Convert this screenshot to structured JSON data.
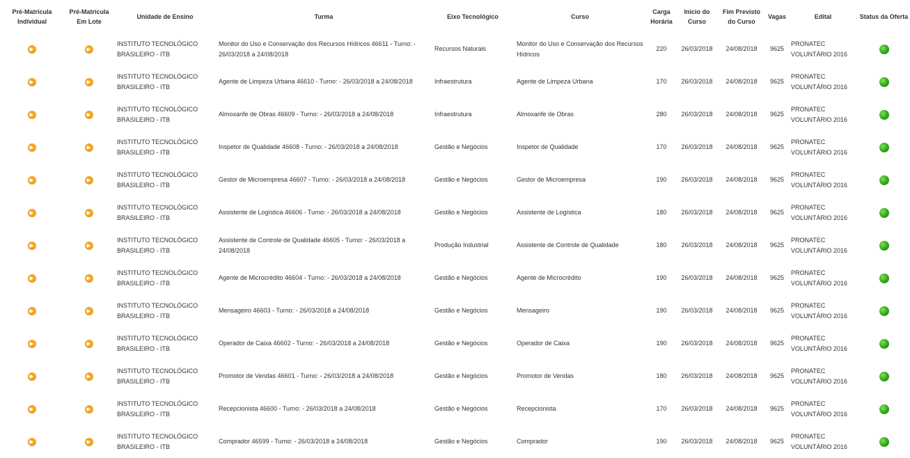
{
  "headers": {
    "pre_individual": "Pré-Matrícula Individual",
    "pre_lote": "Pré-Matrícula Em Lote",
    "unidade": "Unidade de Ensino",
    "turma": "Turma",
    "eixo": "Eixo Tecnológico",
    "curso": "Curso",
    "carga": "Carga Horária",
    "inicio": "Inicio do Curso",
    "fim": "Fim Previsto do Curso",
    "vagas": "Vagas",
    "edital": "Edital",
    "status": "Status da Oferta"
  },
  "icons": {
    "pre_matricula": "arrow-right-circle-icon",
    "status": "green-status-dot-icon"
  },
  "colors": {
    "arrow_button": "#f5a623",
    "status_active": "#2fa51a"
  },
  "rows": [
    {
      "unidade": "INSTITUTO TECNOLÓGICO BRASILEIRO - ITB",
      "turma": "Monitor do Uso e Conservação dos Recursos Hídricos 46611 - Turno: - 26/03/2018 a 24/08/2018",
      "eixo": "Recursos Naturais",
      "curso": "Monitor do Uso e Conservação dos Recursos Hídricos",
      "carga": "220",
      "inicio": "26/03/2018",
      "fim": "24/08/2018",
      "vagas": "9625",
      "edital": "PRONATEC VOLUNTÁRIO 2016"
    },
    {
      "unidade": "INSTITUTO TECNOLÓGICO BRASILEIRO - ITB",
      "turma": "Agente de Limpeza Urbana 46610 - Turno: - 26/03/2018 a 24/08/2018",
      "eixo": "Infraestrutura",
      "curso": "Agente de Limpeza Urbana",
      "carga": "170",
      "inicio": "26/03/2018",
      "fim": "24/08/2018",
      "vagas": "9625",
      "edital": "PRONATEC VOLUNTÁRIO 2016"
    },
    {
      "unidade": "INSTITUTO TECNOLÓGICO BRASILEIRO - ITB",
      "turma": "Almoxarife de Obras 46609 - Turno: - 26/03/2018 a 24/08/2018",
      "eixo": "Infraestrutura",
      "curso": "Almoxarife de Obras",
      "carga": "280",
      "inicio": "26/03/2018",
      "fim": "24/08/2018",
      "vagas": "9625",
      "edital": "PRONATEC VOLUNTÁRIO 2016"
    },
    {
      "unidade": "INSTITUTO TECNOLÓGICO BRASILEIRO - ITB",
      "turma": "Inspetor de Qualidade 46608 - Turno: - 26/03/2018 a 24/08/2018",
      "eixo": "Gestão e Negócios",
      "curso": "Inspetor de Qualidade",
      "carga": "170",
      "inicio": "26/03/2018",
      "fim": "24/08/2018",
      "vagas": "9625",
      "edital": "PRONATEC VOLUNTÁRIO 2016"
    },
    {
      "unidade": "INSTITUTO TECNOLÓGICO BRASILEIRO - ITB",
      "turma": "Gestor de Microempresa 46607 - Turno: - 26/03/2018 a 24/08/2018",
      "eixo": "Gestão e Negócios",
      "curso": "Gestor de Microempresa",
      "carga": "190",
      "inicio": "26/03/2018",
      "fim": "24/08/2018",
      "vagas": "9625",
      "edital": "PRONATEC VOLUNTÁRIO 2016"
    },
    {
      "unidade": "INSTITUTO TECNOLÓGICO BRASILEIRO - ITB",
      "turma": "Assistente de Logística 46606 - Turno: - 26/03/2018 a 24/08/2018",
      "eixo": "Gestão e Negócios",
      "curso": "Assistente de Logística",
      "carga": "180",
      "inicio": "26/03/2018",
      "fim": "24/08/2018",
      "vagas": "9625",
      "edital": "PRONATEC VOLUNTÁRIO 2016"
    },
    {
      "unidade": "INSTITUTO TECNOLÓGICO BRASILEIRO - ITB",
      "turma": "Assistente de Controle de Qualidade 46605 - Turno: - 26/03/2018 a 24/08/2018",
      "eixo": "Produção Industrial",
      "curso": "Assistente de Controle de Qualidade",
      "carga": "180",
      "inicio": "26/03/2018",
      "fim": "24/08/2018",
      "vagas": "9625",
      "edital": "PRONATEC VOLUNTÁRIO 2016"
    },
    {
      "unidade": "INSTITUTO TECNOLÓGICO BRASILEIRO - ITB",
      "turma": "Agente de Microcrédito 46604 - Turno: - 26/03/2018 a 24/08/2018",
      "eixo": "Gestão e Negócios",
      "curso": "Agente de Microcrédito",
      "carga": "190",
      "inicio": "26/03/2018",
      "fim": "24/08/2018",
      "vagas": "9625",
      "edital": "PRONATEC VOLUNTÁRIO 2016"
    },
    {
      "unidade": "INSTITUTO TECNOLÓGICO BRASILEIRO - ITB",
      "turma": "Mensageiro 46603 - Turno: - 26/03/2018 a 24/08/2018",
      "eixo": "Gestão e Negócios",
      "curso": "Mensageiro",
      "carga": "190",
      "inicio": "26/03/2018",
      "fim": "24/08/2018",
      "vagas": "9625",
      "edital": "PRONATEC VOLUNTÁRIO 2016"
    },
    {
      "unidade": "INSTITUTO TECNOLÓGICO BRASILEIRO - ITB",
      "turma": "Operador de Caixa 46602 - Turno: - 26/03/2018 a 24/08/2018",
      "eixo": "Gestão e Negócios",
      "curso": "Operador de Caixa",
      "carga": "190",
      "inicio": "26/03/2018",
      "fim": "24/08/2018",
      "vagas": "9625",
      "edital": "PRONATEC VOLUNTÁRIO 2016"
    },
    {
      "unidade": "INSTITUTO TECNOLÓGICO BRASILEIRO - ITB",
      "turma": "Promotor de Vendas 46601 - Turno: - 26/03/2018 a 24/08/2018",
      "eixo": "Gestão e Negócios",
      "curso": "Promotor de Vendas",
      "carga": "180",
      "inicio": "26/03/2018",
      "fim": "24/08/2018",
      "vagas": "9625",
      "edital": "PRONATEC VOLUNTÁRIO 2016"
    },
    {
      "unidade": "INSTITUTO TECNOLÓGICO BRASILEIRO - ITB",
      "turma": "Recepcionista 46600 - Turno: - 26/03/2018 a 24/08/2018",
      "eixo": "Gestão e Negócios",
      "curso": "Recepcionista",
      "carga": "170",
      "inicio": "26/03/2018",
      "fim": "24/08/2018",
      "vagas": "9625",
      "edital": "PRONATEC VOLUNTÁRIO 2016"
    },
    {
      "unidade": "INSTITUTO TECNOLÓGICO BRASILEIRO - ITB",
      "turma": "Comprador 46599 - Turno: - 26/03/2018 a 24/08/2018",
      "eixo": "Gestão e Negócios",
      "curso": "Comprador",
      "carga": "190",
      "inicio": "26/03/2018",
      "fim": "24/08/2018",
      "vagas": "9625",
      "edital": "PRONATEC VOLUNTÁRIO 2016"
    }
  ]
}
